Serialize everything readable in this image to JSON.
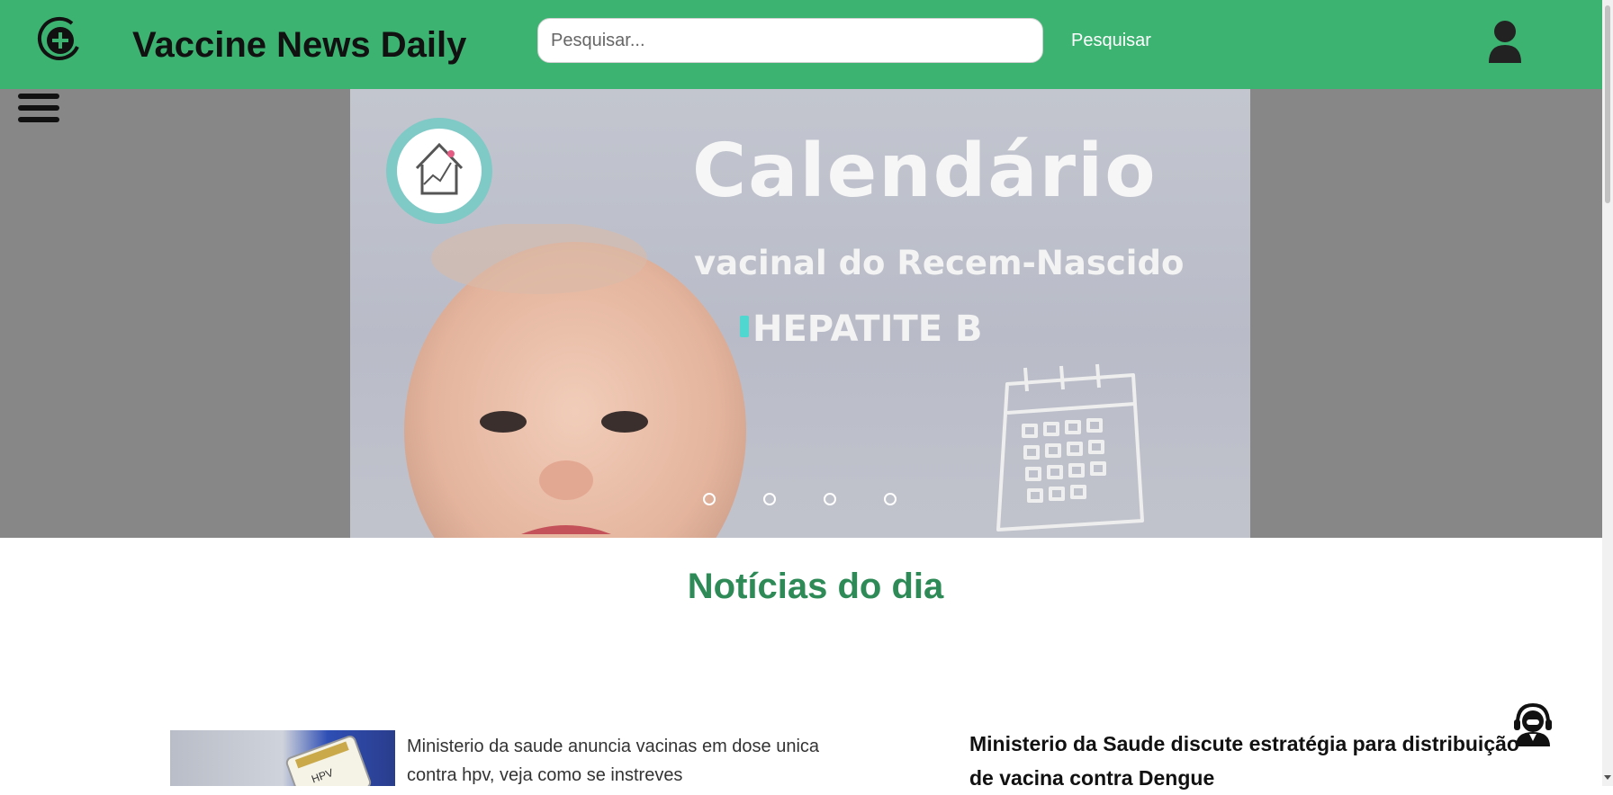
{
  "header": {
    "site_title": "Vaccine News Daily",
    "search_placeholder": "Pesquisar...",
    "search_button": "Pesquisar",
    "logo_icon": "plus-circle-icon",
    "user_icon": "user-icon",
    "background_color": "#3cb371"
  },
  "carousel": {
    "title": "Calendário",
    "subtitle": "vacinal do Recem-Nascido",
    "tag": "HEPATITE B",
    "slide_count": 4,
    "menu_icon": "hamburger-menu-icon"
  },
  "news": {
    "section_title": "Notícias do dia",
    "title_color": "#2e8b57",
    "items": [
      {
        "text": "Ministerio da saude anuncia vacinas em dose unica contra hpv, veja como se instreves"
      },
      {
        "text": "Ministerio da Saude discute estratégia para distribuição de vacina contra Dengue"
      }
    ]
  },
  "support_icon": "support-agent-icon"
}
